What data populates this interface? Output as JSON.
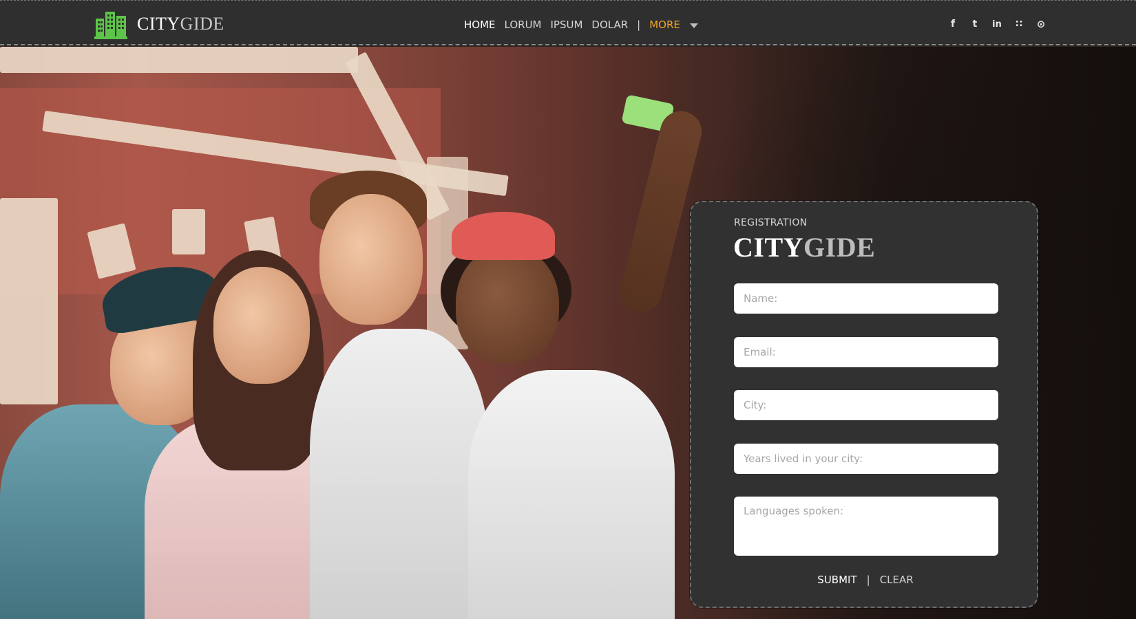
{
  "header": {
    "logo": {
      "name_part1": "CITY",
      "name_part2": "GIDE",
      "icon": "city-buildings-icon",
      "icon_color": "#5dc44a"
    },
    "nav": {
      "items": [
        {
          "label": "HOME"
        },
        {
          "label": "LORUM"
        },
        {
          "label": "IPSUM"
        },
        {
          "label": "DOLAR"
        }
      ],
      "separator": "|",
      "more_label": "MORE",
      "more_color": "#f4a62a"
    },
    "social": [
      {
        "icon": "facebook-icon",
        "glyph": "f"
      },
      {
        "icon": "twitter-icon",
        "glyph": "t"
      },
      {
        "icon": "linkedin-icon",
        "glyph": "in"
      },
      {
        "icon": "rss-icon",
        "glyph": "∷"
      },
      {
        "icon": "dribbble-icon",
        "glyph": "⊙"
      }
    ]
  },
  "registration": {
    "label": "REGISTRATION",
    "brand_part1": "CITY",
    "brand_part2": "GIDE",
    "fields": {
      "name_placeholder": "Name:",
      "email_placeholder": "Email:",
      "city_placeholder": "City:",
      "years_placeholder": "Years lived in your city:",
      "languages_placeholder": "Languages spoken:"
    },
    "submit_label": "SUBMIT",
    "divider": "|",
    "clear_label": "CLEAR"
  },
  "colors": {
    "header_bg": "#2f2f2f",
    "panel_bg": "#313131",
    "accent": "#f4a62a",
    "logo_green": "#5dc44a"
  }
}
